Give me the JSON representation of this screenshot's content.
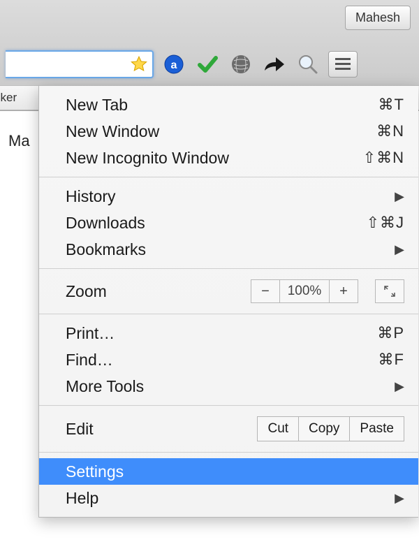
{
  "user_button_label": "Mahesh",
  "bookmark_fragment": "cker",
  "page_text_fragment": "Ma",
  "menu": {
    "section1": {
      "new_tab": {
        "label": "New Tab",
        "shortcut": "⌘T"
      },
      "new_window": {
        "label": "New Window",
        "shortcut": "⌘N"
      },
      "incognito": {
        "label": "New Incognito Window",
        "shortcut": "⇧⌘N"
      }
    },
    "section2": {
      "history": {
        "label": "History",
        "arrow": "▶"
      },
      "downloads": {
        "label": "Downloads",
        "shortcut": "⇧⌘J"
      },
      "bookmarks": {
        "label": "Bookmarks",
        "arrow": "▶"
      }
    },
    "section3": {
      "zoom_label": "Zoom",
      "zoom_value": "100%"
    },
    "section4": {
      "print": {
        "label": "Print…",
        "shortcut": "⌘P"
      },
      "find": {
        "label": "Find…",
        "shortcut": "⌘F"
      },
      "more_tools": {
        "label": "More Tools",
        "arrow": "▶"
      }
    },
    "section5": {
      "edit_label": "Edit",
      "cut": "Cut",
      "copy": "Copy",
      "paste": "Paste"
    },
    "section6": {
      "settings": {
        "label": "Settings"
      },
      "help": {
        "label": "Help",
        "arrow": "▶"
      }
    }
  }
}
